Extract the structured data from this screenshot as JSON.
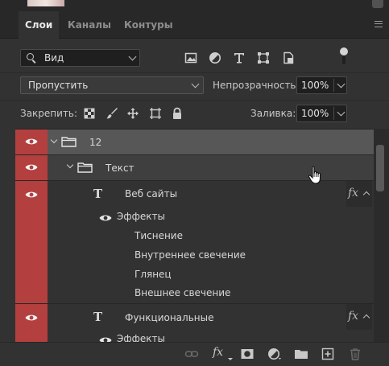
{
  "tabs": [
    {
      "label": "Слои",
      "active": true
    },
    {
      "label": "Каналы",
      "active": false
    },
    {
      "label": "Контуры",
      "active": false
    }
  ],
  "filter": {
    "kind_label": "Вид",
    "icons": [
      "image-filter-icon",
      "adjustment-filter-icon",
      "type-filter-icon",
      "shape-filter-icon",
      "smart-object-filter-icon"
    ]
  },
  "blend": {
    "mode": "Пропустить",
    "opacity_label": "Непрозрачность:",
    "opacity_value": "100%"
  },
  "lock": {
    "label": "Закрепить:",
    "icons": [
      "lock-transparent-pixels-icon",
      "lock-image-pixels-icon",
      "lock-position-icon",
      "lock-artboard-icon",
      "lock-all-icon"
    ],
    "fill_label": "Заливка:",
    "fill_value": "100%"
  },
  "layers": [
    {
      "type": "group",
      "name": "12",
      "visible": true,
      "expanded": true,
      "selected": true
    },
    {
      "type": "group",
      "name": "Текст",
      "visible": true,
      "expanded": true
    },
    {
      "type": "text",
      "name": "Веб сайты",
      "visible": true,
      "fx": "fx",
      "effects_label": "Эффекты",
      "effects": [
        "Тиснение",
        "Внутреннее свечение",
        "Глянец",
        "Внешнее свечение"
      ]
    },
    {
      "type": "text",
      "name": "Функциональные",
      "visible": true,
      "fx": "fx",
      "effects_label": "Эффекты"
    }
  ],
  "bottom_icons": [
    "link-layers-icon",
    "add-style-icon",
    "add-mask-icon",
    "adjustment-layer-icon",
    "new-group-icon",
    "new-layer-icon",
    "delete-layer-icon"
  ],
  "bottom_fx_label": "fx",
  "colors": {
    "panel_bg": "#323232",
    "eye_column": "#b33f3f",
    "selected_row": "#575757"
  }
}
